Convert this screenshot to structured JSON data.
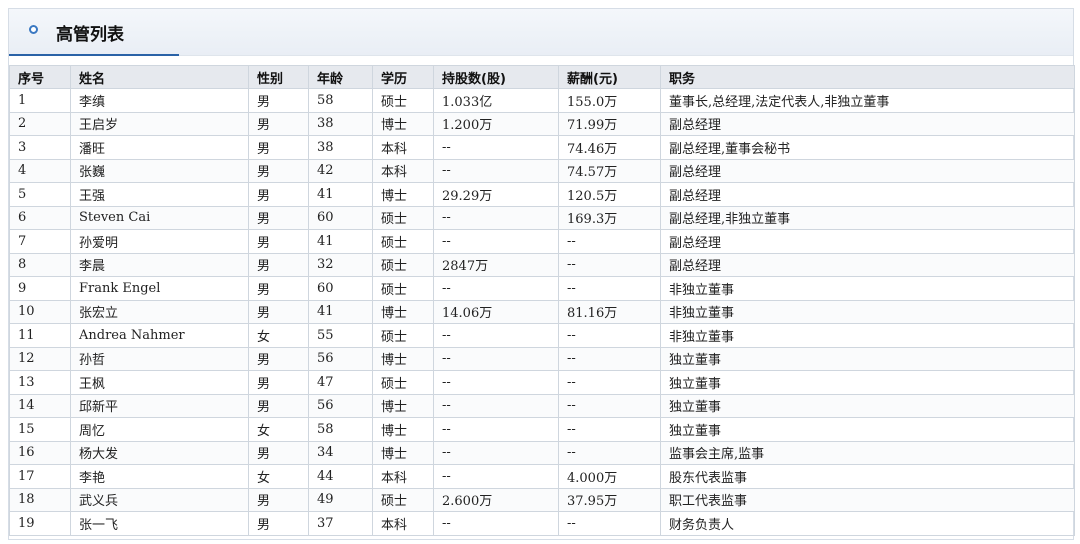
{
  "header": {
    "title": "高管列表"
  },
  "table": {
    "columns": [
      "序号",
      "姓名",
      "性别",
      "年龄",
      "学历",
      "持股数(股)",
      "薪酬(元)",
      "职务"
    ],
    "rows": [
      [
        "1",
        "李缜",
        "男",
        "58",
        "硕士",
        "1.033亿",
        "155.0万",
        "董事长,总经理,法定代表人,非独立董事"
      ],
      [
        "2",
        "王启岁",
        "男",
        "38",
        "博士",
        "1.200万",
        "71.99万",
        "副总经理"
      ],
      [
        "3",
        "潘旺",
        "男",
        "38",
        "本科",
        "--",
        "74.46万",
        "副总经理,董事会秘书"
      ],
      [
        "4",
        "张巍",
        "男",
        "42",
        "本科",
        "--",
        "74.57万",
        "副总经理"
      ],
      [
        "5",
        "王强",
        "男",
        "41",
        "博士",
        "29.29万",
        "120.5万",
        "副总经理"
      ],
      [
        "6",
        "Steven Cai",
        "男",
        "60",
        "硕士",
        "--",
        "169.3万",
        "副总经理,非独立董事"
      ],
      [
        "7",
        "孙爱明",
        "男",
        "41",
        "硕士",
        "--",
        "--",
        "副总经理"
      ],
      [
        "8",
        "李晨",
        "男",
        "32",
        "硕士",
        "2847万",
        "--",
        "副总经理"
      ],
      [
        "9",
        "Frank Engel",
        "男",
        "60",
        "硕士",
        "--",
        "--",
        "非独立董事"
      ],
      [
        "10",
        "张宏立",
        "男",
        "41",
        "博士",
        "14.06万",
        "81.16万",
        "非独立董事"
      ],
      [
        "11",
        "Andrea Nahmer",
        "女",
        "55",
        "硕士",
        "--",
        "--",
        "非独立董事"
      ],
      [
        "12",
        "孙哲",
        "男",
        "56",
        "博士",
        "--",
        "--",
        "独立董事"
      ],
      [
        "13",
        "王枫",
        "男",
        "47",
        "硕士",
        "--",
        "--",
        "独立董事"
      ],
      [
        "14",
        "邱新平",
        "男",
        "56",
        "博士",
        "--",
        "--",
        "独立董事"
      ],
      [
        "15",
        "周忆",
        "女",
        "58",
        "博士",
        "--",
        "--",
        "独立董事"
      ],
      [
        "16",
        "杨大发",
        "男",
        "34",
        "博士",
        "--",
        "--",
        "监事会主席,监事"
      ],
      [
        "17",
        "李艳",
        "女",
        "44",
        "本科",
        "--",
        "4.000万",
        "股东代表监事"
      ],
      [
        "18",
        "武义兵",
        "男",
        "49",
        "硕士",
        "2.600万",
        "37.95万",
        "职工代表监事"
      ],
      [
        "19",
        "张一飞",
        "男",
        "37",
        "本科",
        "--",
        "--",
        "财务负责人"
      ]
    ]
  }
}
